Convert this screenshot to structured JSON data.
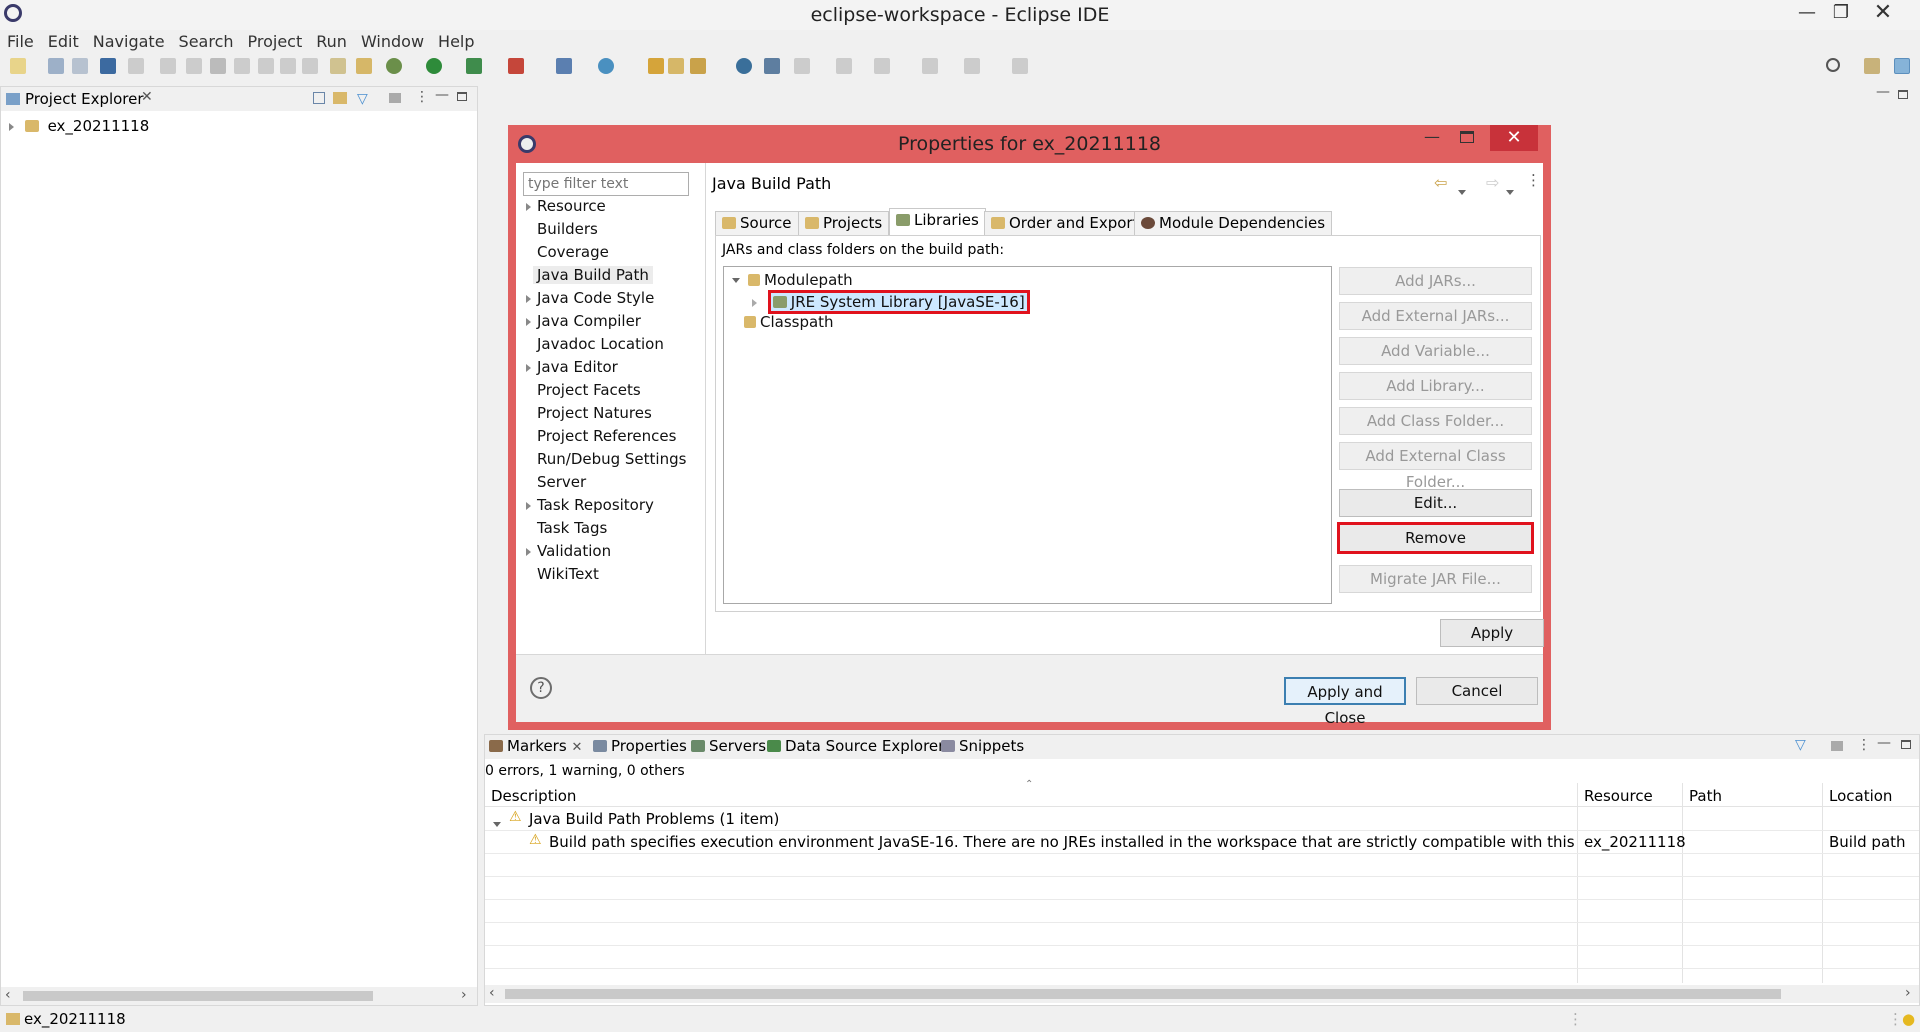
{
  "window": {
    "title": "eclipse-workspace - Eclipse IDE"
  },
  "menu": [
    "File",
    "Edit",
    "Navigate",
    "Search",
    "Project",
    "Run",
    "Window",
    "Help"
  ],
  "project_explorer": {
    "tab_label": "Project Explorer",
    "items": [
      {
        "label": "ex_20211118"
      }
    ]
  },
  "dialog": {
    "title": "Properties for ex_20211118",
    "filter_placeholder": "type filter text",
    "nav_items": [
      {
        "label": "Resource",
        "expandable": true
      },
      {
        "label": "Builders",
        "expandable": false
      },
      {
        "label": "Coverage",
        "expandable": false
      },
      {
        "label": "Java Build Path",
        "expandable": false,
        "selected": true
      },
      {
        "label": "Java Code Style",
        "expandable": true
      },
      {
        "label": "Java Compiler",
        "expandable": true
      },
      {
        "label": "Javadoc Location",
        "expandable": false
      },
      {
        "label": "Java Editor",
        "expandable": true
      },
      {
        "label": "Project Facets",
        "expandable": false
      },
      {
        "label": "Project Natures",
        "expandable": false
      },
      {
        "label": "Project References",
        "expandable": false
      },
      {
        "label": "Run/Debug Settings",
        "expandable": false
      },
      {
        "label": "Server",
        "expandable": false
      },
      {
        "label": "Task Repository",
        "expandable": true
      },
      {
        "label": "Task Tags",
        "expandable": false
      },
      {
        "label": "Validation",
        "expandable": true
      },
      {
        "label": "WikiText",
        "expandable": false
      }
    ],
    "page_title": "Java Build Path",
    "tabs": [
      "Source",
      "Projects",
      "Libraries",
      "Order and Export",
      "Module Dependencies"
    ],
    "active_tab": "Libraries",
    "list_caption": "JARs and class folders on the build path:",
    "tree": {
      "modulepath": "Modulepath",
      "jre": "JRE System Library [JavaSE-16]",
      "classpath": "Classpath"
    },
    "buttons": {
      "add_jars": "Add JARs...",
      "add_external_jars": "Add External JARs...",
      "add_variable": "Add Variable...",
      "add_library": "Add Library...",
      "add_class_folder": "Add Class Folder...",
      "add_external_class_folder": "Add External Class Folder...",
      "edit": "Edit...",
      "remove": "Remove",
      "migrate_jar": "Migrate JAR File...",
      "apply": "Apply",
      "apply_and_close": "Apply and Close",
      "cancel": "Cancel"
    },
    "highlight_color": "#e0121d"
  },
  "bottom_panel": {
    "tabs": [
      "Markers",
      "Properties",
      "Servers",
      "Data Source Explorer",
      "Snippets"
    ],
    "summary": "0 errors, 1 warning, 0 others",
    "columns": [
      "Description",
      "Resource",
      "Path",
      "Location"
    ],
    "group": "Java Build Path Problems (1 item)",
    "row": {
      "description": "Build path specifies execution environment JavaSE-16. There are no JREs installed in the workspace that are strictly compatible with this environment.",
      "resource": "ex_20211118",
      "path": "",
      "location": "Build path"
    }
  },
  "status_bar": {
    "selection": "ex_20211118"
  }
}
